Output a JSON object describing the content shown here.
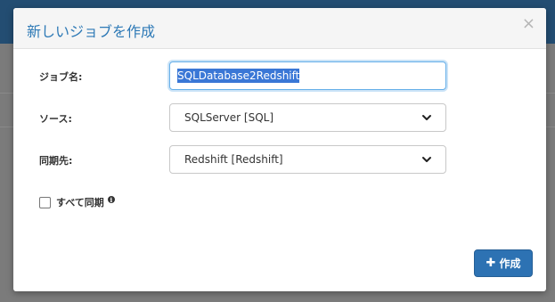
{
  "modal": {
    "title": "新しいジョブを作成",
    "close_symbol": "×"
  },
  "form": {
    "job_name_label": "ジョブ名:",
    "job_name_value": "SQLDatabase2Redshift",
    "source_label": "ソース:",
    "source_selected": "SQLServer [SQL]",
    "destination_label": "同期先:",
    "destination_selected": "Redshift [Redshift]",
    "sync_all_label": "すべて同期",
    "sync_all_checked": false,
    "info_symbol": "i"
  },
  "actions": {
    "create_label": "作成",
    "create_icon": "plus-icon"
  },
  "colors": {
    "title": "#2d79b6",
    "primary_button": "#2d72b3",
    "header_bar": "#234d72"
  }
}
